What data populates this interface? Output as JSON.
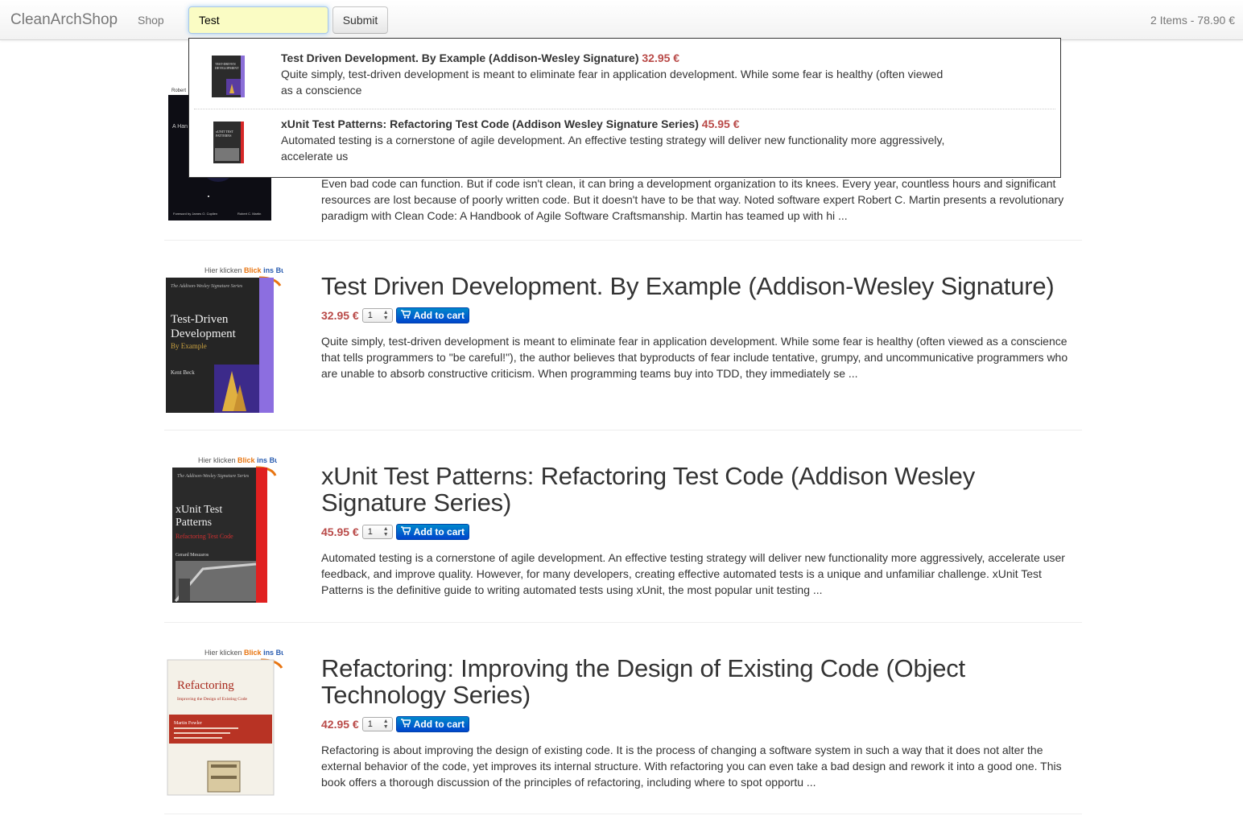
{
  "navbar": {
    "brand": "CleanArchShop",
    "nav_shop": "Shop",
    "search_value": "Test",
    "submit_label": "Submit",
    "cart_summary": "2 Items - 78.90 €"
  },
  "autocomplete": [
    {
      "title": "Test Driven Development. By Example (Addison-Wesley Signature)",
      "price": "32.95 €",
      "desc1": "Quite simply, test-driven development is meant to eliminate fear in application development. While some fear is healthy (often viewed",
      "desc2": "as a conscience"
    },
    {
      "title": "xUnit Test Patterns: Refactoring Test Code (Addison Wesley Signature Series)",
      "price": "45.95 €",
      "desc1": "Automated testing is a cornerstone of agile development. An effective testing strategy will deliver new functionality more aggressively,",
      "desc2": "accelerate us"
    }
  ],
  "products": [
    {
      "cover_brand": "Robert C. Martin",
      "cover_foreword": "Foreword by James O. Coplien",
      "desc": "Even bad code can function. But if code isn't clean, it can bring a development organization to its knees. Every year, countless hours and significant resources are lost because of poorly written code. But it doesn't have to be that way. Noted software expert Robert C. Martin presents a revolutionary paradigm with Clean Code: A Handbook of Agile Software Craftsmanship. Martin has teamed up with hi ..."
    },
    {
      "title": "Test Driven Development. By Example (Addison-Wesley Signature)",
      "price": "32.95 €",
      "qty": "1",
      "add_label": "Add to cart",
      "desc": "Quite simply, test-driven development is meant to eliminate fear in application development. While some fear is healthy (often viewed as a conscience that tells programmers to \"be careful!\"), the author believes that byproducts of fear include tentative, grumpy, and uncommunicative programmers who are unable to absorb constructive criticism. When programming teams buy into TDD, they immediately se ...",
      "cover_line1": "Test-Driven",
      "cover_line2": "Development",
      "cover_sub": "By Example",
      "cover_author": "Kent Beck"
    },
    {
      "title": "xUnit Test Patterns: Refactoring Test Code (Addison Wesley Signature Series)",
      "price": "45.95 €",
      "qty": "1",
      "add_label": "Add to cart",
      "desc": "Automated testing is a cornerstone of agile development. An effective testing strategy will deliver new functionality more aggressively, accelerate user feedback, and improve quality. However, for many developers, creating effective automated tests is a unique and unfamiliar challenge. xUnit Test Patterns is the definitive guide to writing automated tests using xUnit, the most popular unit testing ...",
      "cover_line1": "xUnit Test",
      "cover_line2": "Patterns",
      "cover_sub": "Refactoring Test Code",
      "cover_author": "Gerard Meszaros"
    },
    {
      "title": "Refactoring: Improving the Design of Existing Code (Object Technology Series)",
      "price": "42.95 €",
      "qty": "1",
      "add_label": "Add to cart",
      "desc": "Refactoring is about improving the design of existing code. It is the process of changing a software system in such a way that it does not alter the external behavior of the code, yet improves its internal structure. With refactoring you can even take a bad design and rework it into a good one. This book offers a thorough discussion of the principles of refactoring, including where to spot opportu ...",
      "cover_line1": "Refactoring",
      "cover_sub": "Improving the Design of Existing Code",
      "cover_author": "Martin Fowler"
    }
  ],
  "cover_badge": {
    "part1": "Hier klicken",
    "part2": "Blick",
    "part3": "ins Buch!"
  }
}
